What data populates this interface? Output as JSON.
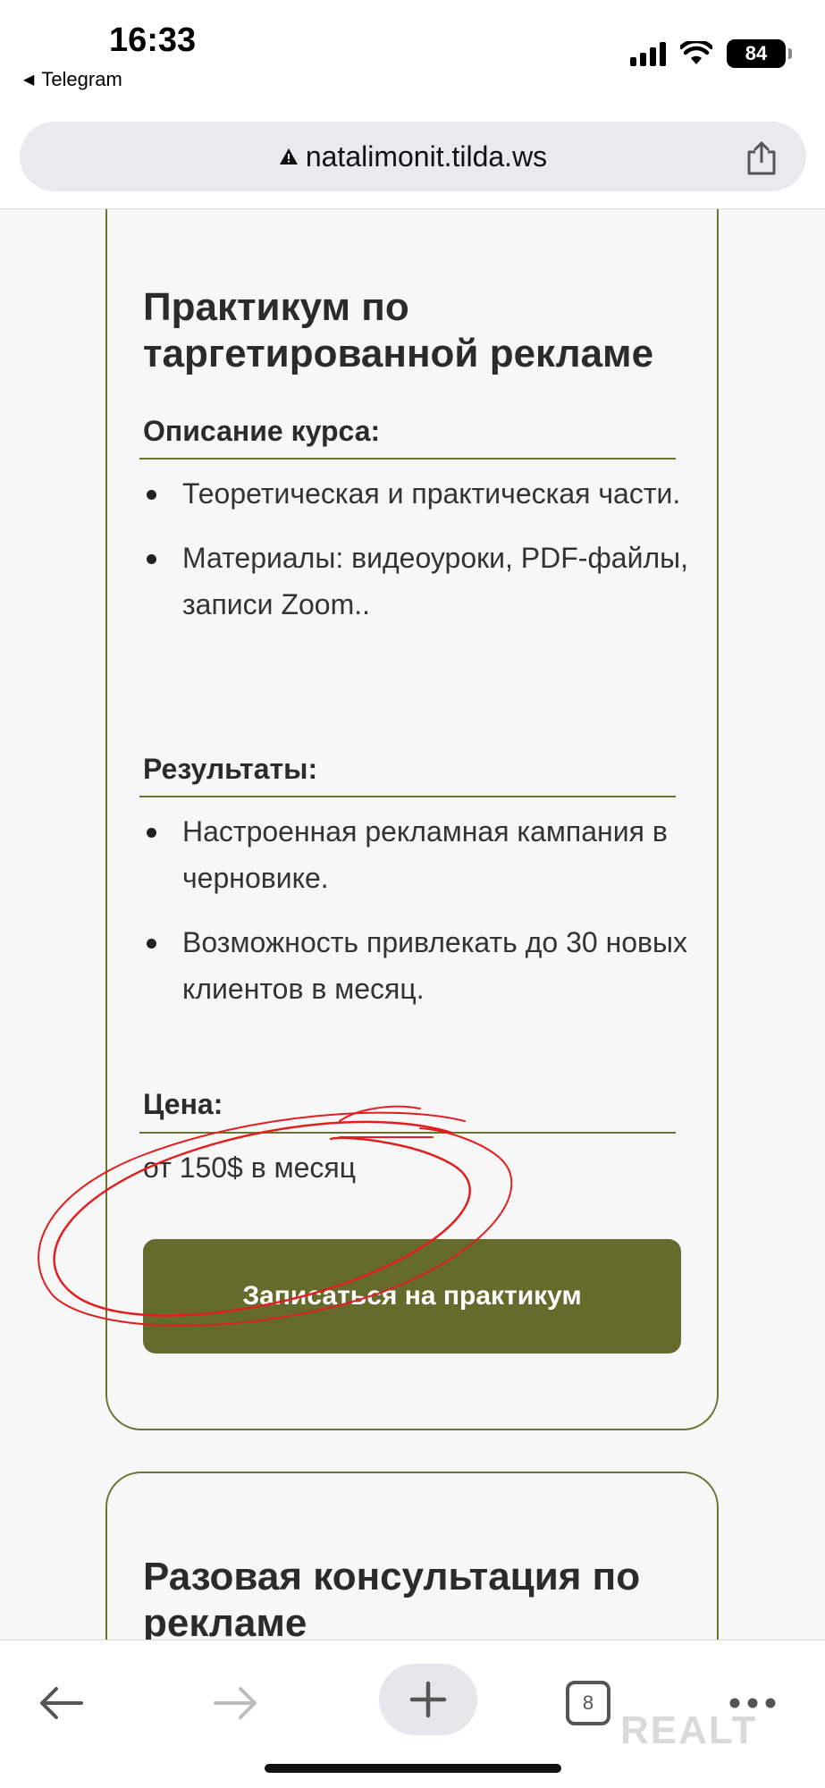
{
  "status": {
    "time": "16:33",
    "back_app": "Telegram",
    "battery": "84"
  },
  "browser": {
    "url": "natalimonit.tilda.ws",
    "tabs_count": "8"
  },
  "card1": {
    "title": "Практикум по таргетированной рекламе",
    "description_label": "Описание курса:",
    "description_items": [
      "Теоретическая и практическая части.",
      "Материалы: видеоуроки, PDF-файлы, записи Zoom.."
    ],
    "results_label": "Результаты:",
    "results_items": [
      "Настроенная рекламная кампания в черновике.",
      "Возможность привлекать до 30 новых клиентов в месяц."
    ],
    "price_label": "Цена:",
    "price_value": "от 150$ в месяц",
    "cta": "Записаться на практикум"
  },
  "card2": {
    "title": "Разовая консультация по рекламе"
  },
  "watermark": "REALT",
  "colors": {
    "accent": "#646b2c",
    "border": "#6b7331",
    "annotation": "#e02020"
  },
  "icons": {
    "url_warning": "warning-icon",
    "share": "share-icon",
    "back": "arrow-left-icon",
    "forward": "arrow-right-icon",
    "new_tab": "plus-icon",
    "tabs": "tabs-icon",
    "more": "more-icon"
  }
}
